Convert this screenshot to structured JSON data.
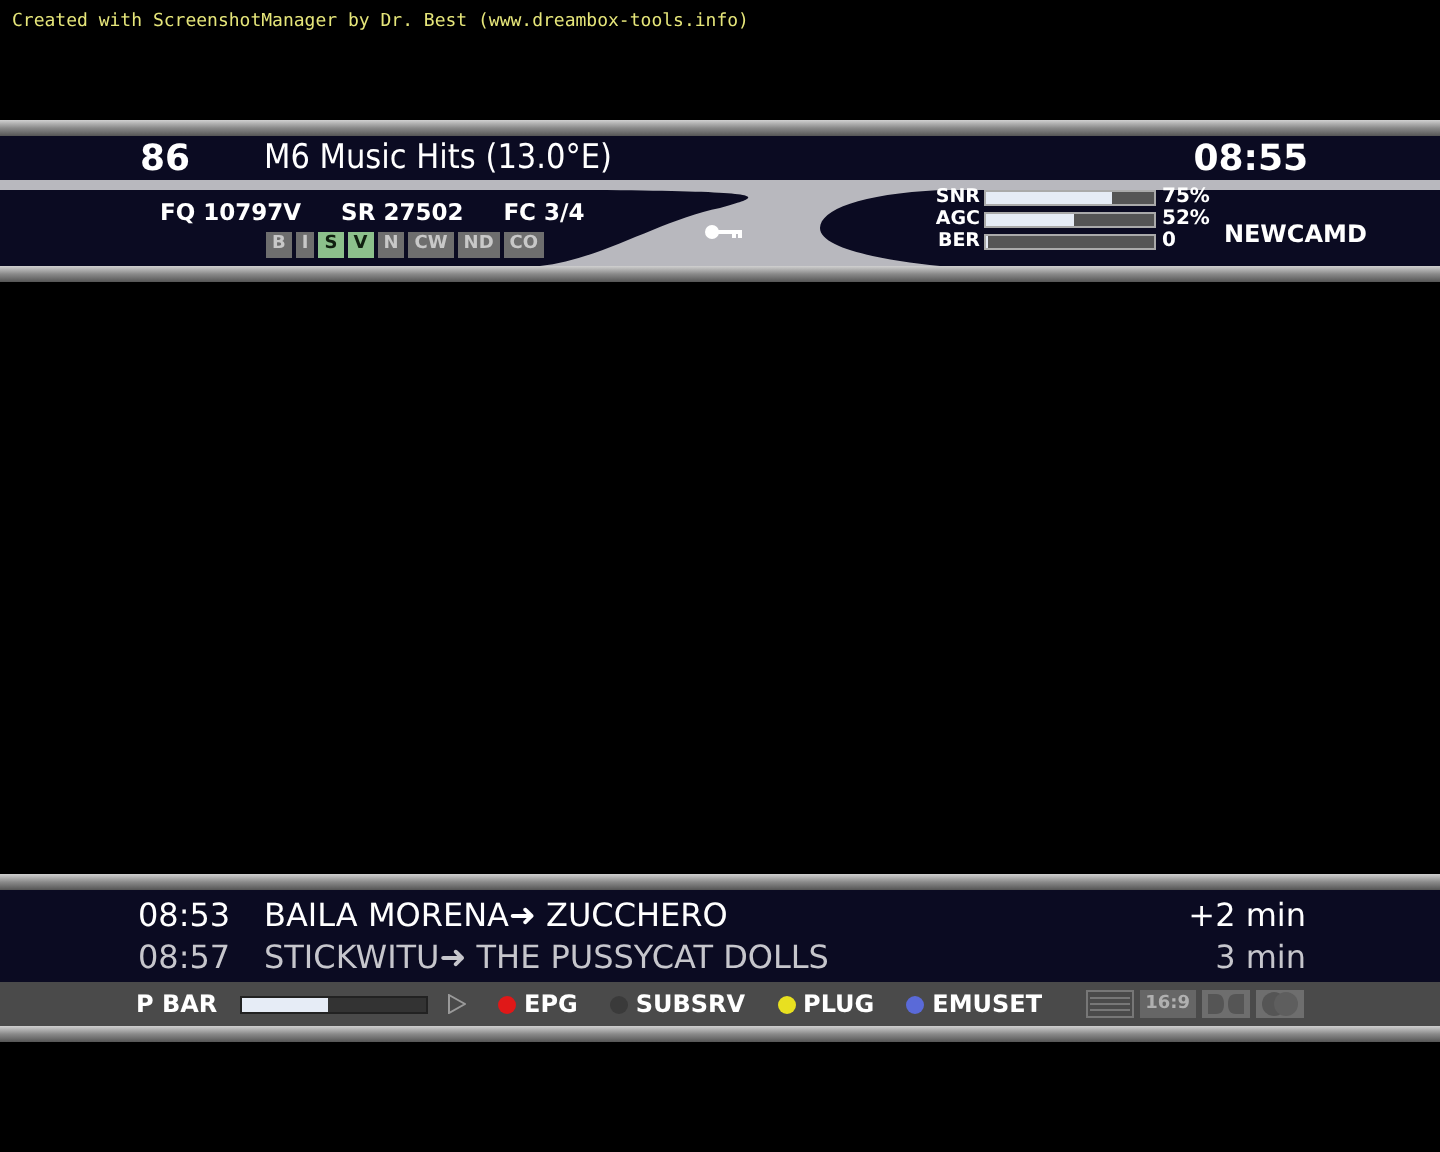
{
  "caption": "Created with ScreenshotManager by Dr. Best (www.dreambox-tools.info)",
  "channel": {
    "number": "86",
    "name": "M6 Music Hits (13.0°E)",
    "time": "08:55"
  },
  "tuning": {
    "frequency": "FQ 10797V",
    "symbol_rate": "SR 27502",
    "fec": "FC 3/4"
  },
  "ca_flags": [
    {
      "label": "B",
      "on": false
    },
    {
      "label": "I",
      "on": false
    },
    {
      "label": "S",
      "on": true
    },
    {
      "label": "V",
      "on": true
    },
    {
      "label": "N",
      "on": false
    },
    {
      "label": "CW",
      "on": false
    },
    {
      "label": "ND",
      "on": false
    },
    {
      "label": "CO",
      "on": false
    }
  ],
  "meters": [
    {
      "name": "SNR",
      "level": 0.75,
      "reading": "75%"
    },
    {
      "name": "AGC",
      "level": 0.52,
      "reading": "52%"
    },
    {
      "name": "BER",
      "level": 0,
      "reading": "0"
    }
  ],
  "cam": "NEWCAMD",
  "epg": [
    {
      "time": "08:53",
      "title": "BAILA MORENA➜ ZUCCHERO",
      "remaining": "+2 min",
      "current": true
    },
    {
      "time": "08:57",
      "title": "STICKWITU➜ THE PUSSYCAT DOLLS",
      "remaining": "3 min",
      "current": false
    }
  ],
  "progress": {
    "label": "P BAR",
    "level": 0.47
  },
  "buttons": [
    {
      "label": "EPG",
      "color": "#e01818"
    },
    {
      "label": "SUBSRV",
      "color": "#3a3a3a"
    },
    {
      "label": "PLUG",
      "color": "#e8e020"
    },
    {
      "label": "EMUSET",
      "color": "#5a6ad8"
    }
  ],
  "aspect": "16:9"
}
